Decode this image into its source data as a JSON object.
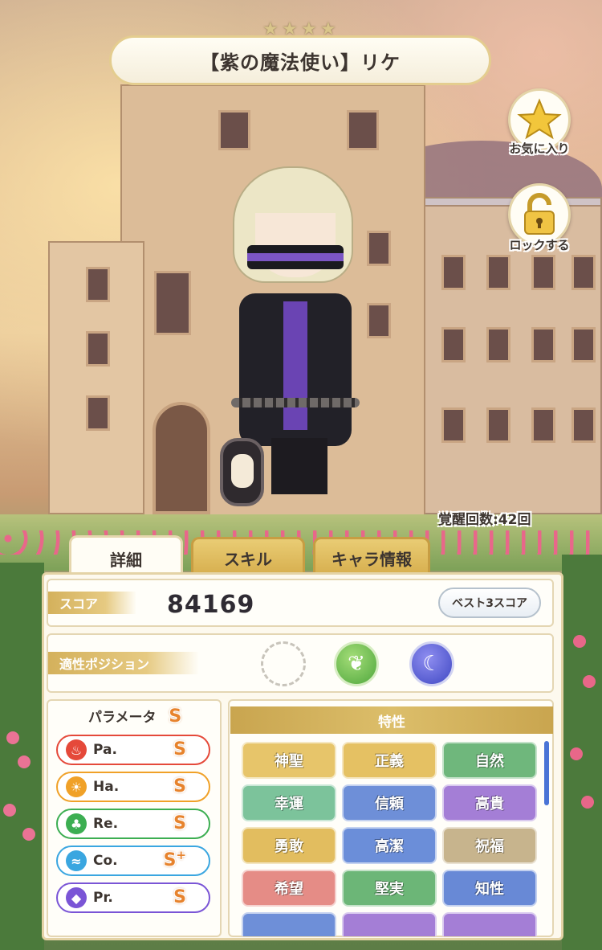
{
  "header": {
    "title": "【紫の魔法使い】リケ",
    "stars": [
      "★",
      "★",
      "★",
      "★"
    ]
  },
  "side_buttons": {
    "favorite_label": "お気に入り",
    "lock_label": "ロックする"
  },
  "awakening": "覚醒回数:42回",
  "tabs": [
    {
      "label": "詳細",
      "active": true
    },
    {
      "label": "スキル",
      "active": false
    },
    {
      "label": "キャラ情報",
      "active": false
    }
  ],
  "score": {
    "label": "スコア",
    "value": "84169",
    "best3_label": "ベスト3スコア"
  },
  "position": {
    "label": "適性ポジション",
    "slots": [
      "empty",
      "green",
      "blue"
    ]
  },
  "parameters": {
    "title": "パラメータ",
    "overall_rank": "S",
    "items": [
      {
        "name": "Pa.",
        "rank": "S",
        "sup": "",
        "color": "#e5493a"
      },
      {
        "name": "Ha.",
        "rank": "S",
        "sup": "",
        "color": "#f0a128"
      },
      {
        "name": "Re.",
        "rank": "S",
        "sup": "",
        "color": "#3cae52"
      },
      {
        "name": "Co.",
        "rank": "S",
        "sup": "+",
        "color": "#3aa6e0"
      },
      {
        "name": "Pr.",
        "rank": "S",
        "sup": "",
        "color": "#7a55d6"
      }
    ]
  },
  "traits": {
    "title": "特性",
    "items": [
      {
        "label": "神聖",
        "color": "#e7c56a"
      },
      {
        "label": "正義",
        "color": "#e5c163"
      },
      {
        "label": "自然",
        "color": "#6fb77c"
      },
      {
        "label": "幸運",
        "color": "#7cc39b"
      },
      {
        "label": "信頼",
        "color": "#6e8fd8"
      },
      {
        "label": "高貴",
        "color": "#a47ed6"
      },
      {
        "label": "勇敢",
        "color": "#e2bd5f"
      },
      {
        "label": "高潔",
        "color": "#6b8ed9"
      },
      {
        "label": "祝福",
        "color": "#c7b48d"
      },
      {
        "label": "希望",
        "color": "#e58c86"
      },
      {
        "label": "堅実",
        "color": "#6cb677"
      },
      {
        "label": "知性",
        "color": "#6889d6"
      },
      {
        "label": "",
        "color": "#6e8fd8"
      },
      {
        "label": "",
        "color": "#a47ed6"
      },
      {
        "label": "",
        "color": "#a47ed6"
      }
    ]
  }
}
